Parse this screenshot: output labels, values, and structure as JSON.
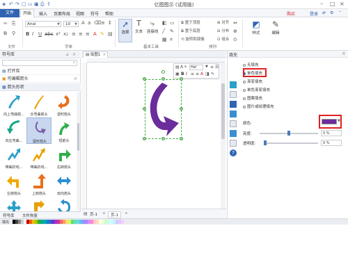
{
  "app": {
    "title": "亿图图示 (试用版)"
  },
  "menu": {
    "file": "文件",
    "items": [
      "开始",
      "插入",
      "页面布局",
      "视图",
      "符号",
      "帮助"
    ],
    "purchase": "购买",
    "login": "登录"
  },
  "ribbon": {
    "font_name": "Arial",
    "font_size": "10",
    "group_file": "文件",
    "group_font": "字体",
    "group_tools": "基本工具",
    "group_arrange": "排列",
    "select_label": "选择",
    "text_label": "文本",
    "connector_label": "连接线",
    "bring_front": "置于顶层",
    "send_back": "置于底层",
    "rotate_mirror": "旋转和镜像",
    "align": "对齐",
    "distribute": "分布",
    "group": "组合",
    "style_label": "样式",
    "edit_label": "编辑"
  },
  "library": {
    "title": "符号库",
    "search_placeholder": "",
    "open_lib": "打开库",
    "basic_lib": "可编辑箭头",
    "category": "箭头形状",
    "shapes": [
      "向上弯曲箭...",
      "长弯曲箭头",
      "逆时箭头",
      "向左弯曲...",
      "弧形箭头",
      "短箭头",
      "带曲折线...",
      "带曲折线...",
      "右转箭头",
      "左转箭头",
      "上转箭头",
      "双向箭头",
      "",
      "",
      ""
    ],
    "tabs": [
      "符号库",
      "文件恢复"
    ]
  },
  "canvas": {
    "tab": "绘图1",
    "page_tab": "页-1",
    "page_tab2": "页-1",
    "mini_font": "Hel"
  },
  "fill": {
    "title": "填充",
    "options": [
      "无填充",
      "单色填充",
      "渐变填充",
      "单色渐变填充",
      "图案填充",
      "图片或纹理填充"
    ],
    "selected": "单色填充",
    "color_label": "颜色:",
    "color_value": "#6b2d9b",
    "brightness_label": "亮度:",
    "brightness_value": "0 %",
    "transparency_label": "透明度:",
    "transparency_value": "0 %"
  },
  "status": {
    "fill_label": "填充"
  },
  "colors": {
    "accent": "#2f64b2",
    "shape_fill": "#6b2d9b",
    "highlight": "#e02020"
  }
}
